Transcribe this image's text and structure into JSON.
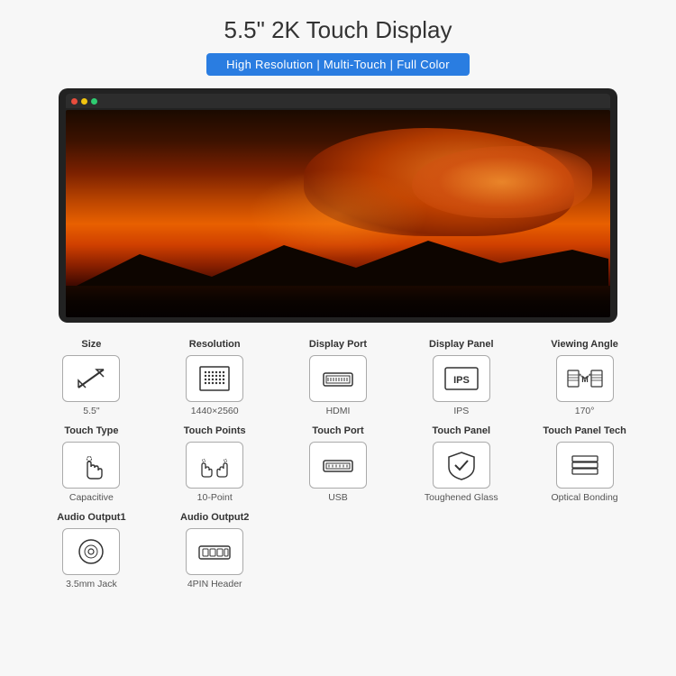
{
  "page": {
    "title": "5.5\" 2K Touch Display",
    "subtitle": "High Resolution | Multi-Touch | Full Color"
  },
  "specs_row1": [
    {
      "label": "Size",
      "value": "5.5\"",
      "icon": "diagonal-arrow"
    },
    {
      "label": "Resolution",
      "value": "1440×2560",
      "icon": "grid-dots"
    },
    {
      "label": "Display Port",
      "value": "HDMI",
      "icon": "hdmi-port"
    },
    {
      "label": "Display Panel",
      "value": "IPS",
      "icon": "ips-panel"
    },
    {
      "label": "Viewing Angle",
      "value": "170°",
      "icon": "viewing-angle"
    }
  ],
  "specs_row2": [
    {
      "label": "Touch Type",
      "value": "Capacitive",
      "icon": "hand-touch"
    },
    {
      "label": "Touch Points",
      "value": "10-Point",
      "icon": "multi-touch"
    },
    {
      "label": "Touch Port",
      "value": "USB",
      "icon": "usb-port"
    },
    {
      "label": "Touch Panel",
      "value": "Toughened Glass",
      "icon": "shield-check"
    },
    {
      "label": "Touch Panel Tech",
      "value": "Optical Bonding",
      "icon": "layers"
    }
  ],
  "specs_row3": [
    {
      "label": "Audio Output1",
      "value": "3.5mm Jack",
      "icon": "audio-jack"
    },
    {
      "label": "Audio Output2",
      "value": "4PIN Header",
      "icon": "pin-header"
    }
  ]
}
